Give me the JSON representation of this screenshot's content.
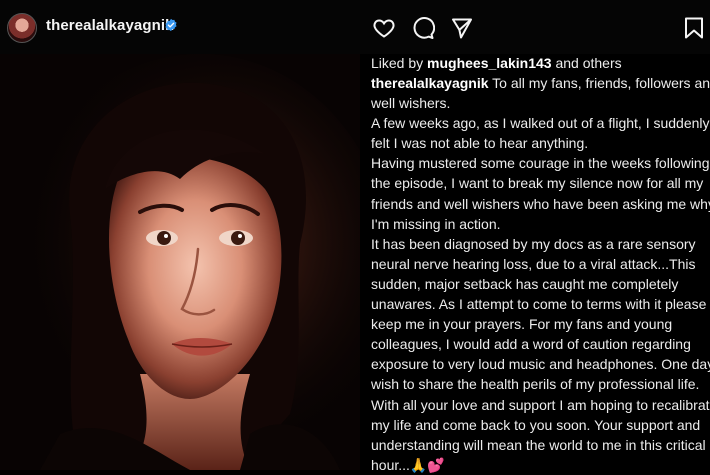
{
  "post_header": {
    "username": "therealalkayagnik"
  },
  "icons": {
    "verified": "verified-badge-icon",
    "like": "heart-icon",
    "comment": "comment-icon",
    "share": "send-icon",
    "save": "bookmark-icon"
  },
  "colors": {
    "verified_blue": "#3897f0",
    "background": "#000000",
    "text": "#ececec"
  },
  "likes": {
    "prefix": "Liked by ",
    "user": "mughees_lakin143",
    "suffix": " and others"
  },
  "caption": {
    "author": "therealalkayagnik",
    "lines": [
      " To all my fans, friends, followers and",
      "well wishers.",
      "A few weeks ago, as I walked out of a flight, I suddenly",
      "felt I was not able to hear anything.",
      "Having mustered some courage in the weeks following",
      "the episode, I want to break my silence now for all my",
      "friends and well wishers who have been asking me why",
      "I'm missing in action.",
      "It has been diagnosed by my docs as a rare sensory",
      "neural nerve hearing loss, due to a viral attack...This",
      "sudden, major setback has caught me completely",
      "unawares. As I attempt to come to terms with it please",
      "keep me in your prayers. For my fans and young",
      "colleagues, I would add a word of caution regarding",
      "exposure to very loud music and headphones. One day, I",
      "wish to share the health perils of my professional life.",
      "With all your love and support I am hoping to recalibrate",
      "my life and come back to you soon. Your support and",
      "understanding will mean the world to me in this critical",
      "hour...🙏💕"
    ]
  }
}
